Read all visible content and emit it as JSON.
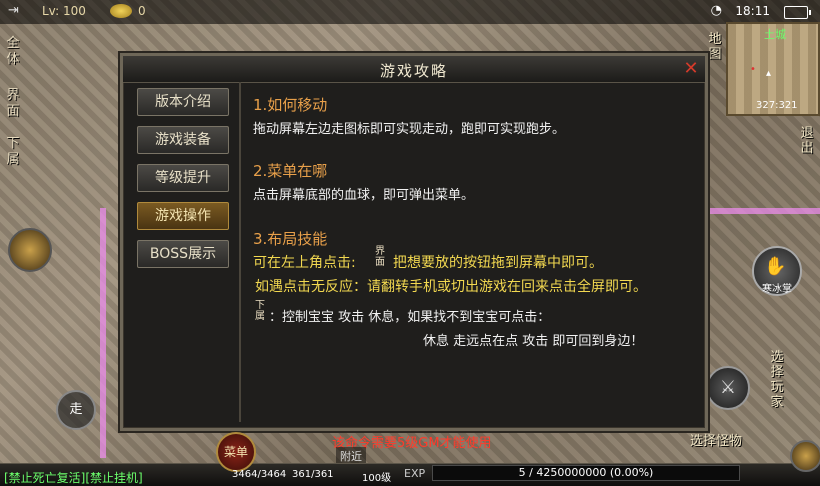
{
  "status_bar": {
    "level": "Lv: 100",
    "gold": "0",
    "time": "18:11"
  },
  "left_buttons": [
    "全体",
    "界面",
    "下属"
  ],
  "minimap": {
    "label": "土城",
    "coords": "327:321"
  },
  "map_button": "地图",
  "right_buttons": {
    "exit": "退出",
    "select_player": "选择玩家",
    "select_monster": "选择怪物",
    "skill": "寒冰掌"
  },
  "dialog": {
    "title": "游戏攻略",
    "tabs": [
      "版本介绍",
      "游戏装备",
      "等级提升",
      "游戏操作",
      "BOSS展示"
    ],
    "active_tab": "游戏操作",
    "sections": [
      {
        "heading": "1.如何移动",
        "text": "拖动屏幕左边走图标即可实现走动，跑即可实现跑步。"
      },
      {
        "heading": "2.菜单在哪",
        "text": "点击屏幕底部的血球，即可弹出菜单。"
      },
      {
        "heading": "3.布局技能",
        "line1_a": "可在左上角点击:",
        "line1_small": "界面",
        "line1_b": "把想要放的按钮拖到屏幕中即可。",
        "line2": "如遇点击无反应：请翻转手机或切出游戏在回来点击全屏即可。",
        "line3_small": "下属",
        "line3": "：控制宝宝 攻击 休息，如果找不到宝宝可点击：",
        "line4": "休息 走远点在点 攻击 即可回到身边！"
      }
    ]
  },
  "bottom": {
    "warning": "该命令需要5级GM才能使用",
    "nearby": "附近",
    "ban_text": "[禁止死亡复活][禁止挂机]",
    "hp": "3464/3464",
    "mp": "361/361",
    "level": "100级",
    "exp_label": "EXP",
    "exp": "5 / 4250000000 (0.00%)",
    "menu": "菜单",
    "walk": "走"
  }
}
